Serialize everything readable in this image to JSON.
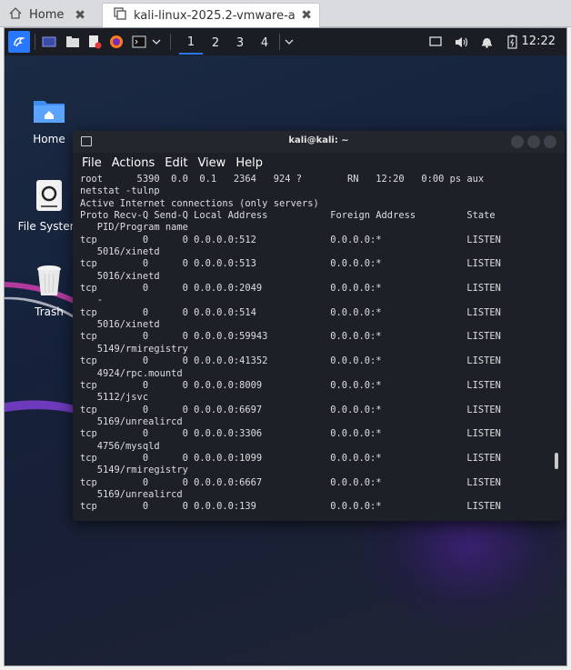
{
  "browser": {
    "tabs": [
      {
        "label": "Home",
        "icon": "home-icon"
      },
      {
        "label": "kali-linux-2025.2-vmware-a",
        "icon": "vm-icon"
      }
    ],
    "close_glyph": "✖"
  },
  "panel": {
    "workspaces": [
      "1",
      "2",
      "3",
      "4"
    ],
    "clock": "12:22"
  },
  "desktop": {
    "icons": [
      {
        "label": "Home"
      },
      {
        "label": "File System"
      },
      {
        "label": "Trash"
      }
    ]
  },
  "terminal": {
    "title": "kali@kali: ~",
    "menu": [
      "File",
      "Actions",
      "Edit",
      "View",
      "Help"
    ],
    "lines": [
      "root      5390  0.0  0.1   2364   924 ?        RN   12:20   0:00 ps aux",
      "netstat -tulnp",
      "Active Internet connections (only servers)",
      "Proto Recv-Q Send-Q Local Address           Foreign Address         State",
      "   PID/Program name",
      "tcp        0      0 0.0.0.0:512             0.0.0.0:*               LISTEN",
      "   5016/xinetd",
      "tcp        0      0 0.0.0.0:513             0.0.0.0:*               LISTEN",
      "   5016/xinetd",
      "tcp        0      0 0.0.0.0:2049            0.0.0.0:*               LISTEN",
      "   -",
      "tcp        0      0 0.0.0.0:514             0.0.0.0:*               LISTEN",
      "   5016/xinetd",
      "tcp        0      0 0.0.0.0:59943           0.0.0.0:*               LISTEN",
      "   5149/rmiregistry",
      "tcp        0      0 0.0.0.0:41352           0.0.0.0:*               LISTEN",
      "   4924/rpc.mountd",
      "tcp        0      0 0.0.0.0:8009            0.0.0.0:*               LISTEN",
      "   5112/jsvc",
      "tcp        0      0 0.0.0.0:6697            0.0.0.0:*               LISTEN",
      "   5169/unrealircd",
      "tcp        0      0 0.0.0.0:3306            0.0.0.0:*               LISTEN",
      "   4756/mysqld",
      "tcp        0      0 0.0.0.0:1099            0.0.0.0:*               LISTEN",
      "   5149/rmiregistry",
      "tcp        0      0 0.0.0.0:6667            0.0.0.0:*               LISTEN",
      "   5169/unrealircd",
      "tcp        0      0 0.0.0.0:139             0.0.0.0:*               LISTEN"
    ]
  },
  "colors": {
    "accent": "#2777ff",
    "panel_bg": "#1a1d23",
    "terminal_bg": "#1d2027"
  }
}
